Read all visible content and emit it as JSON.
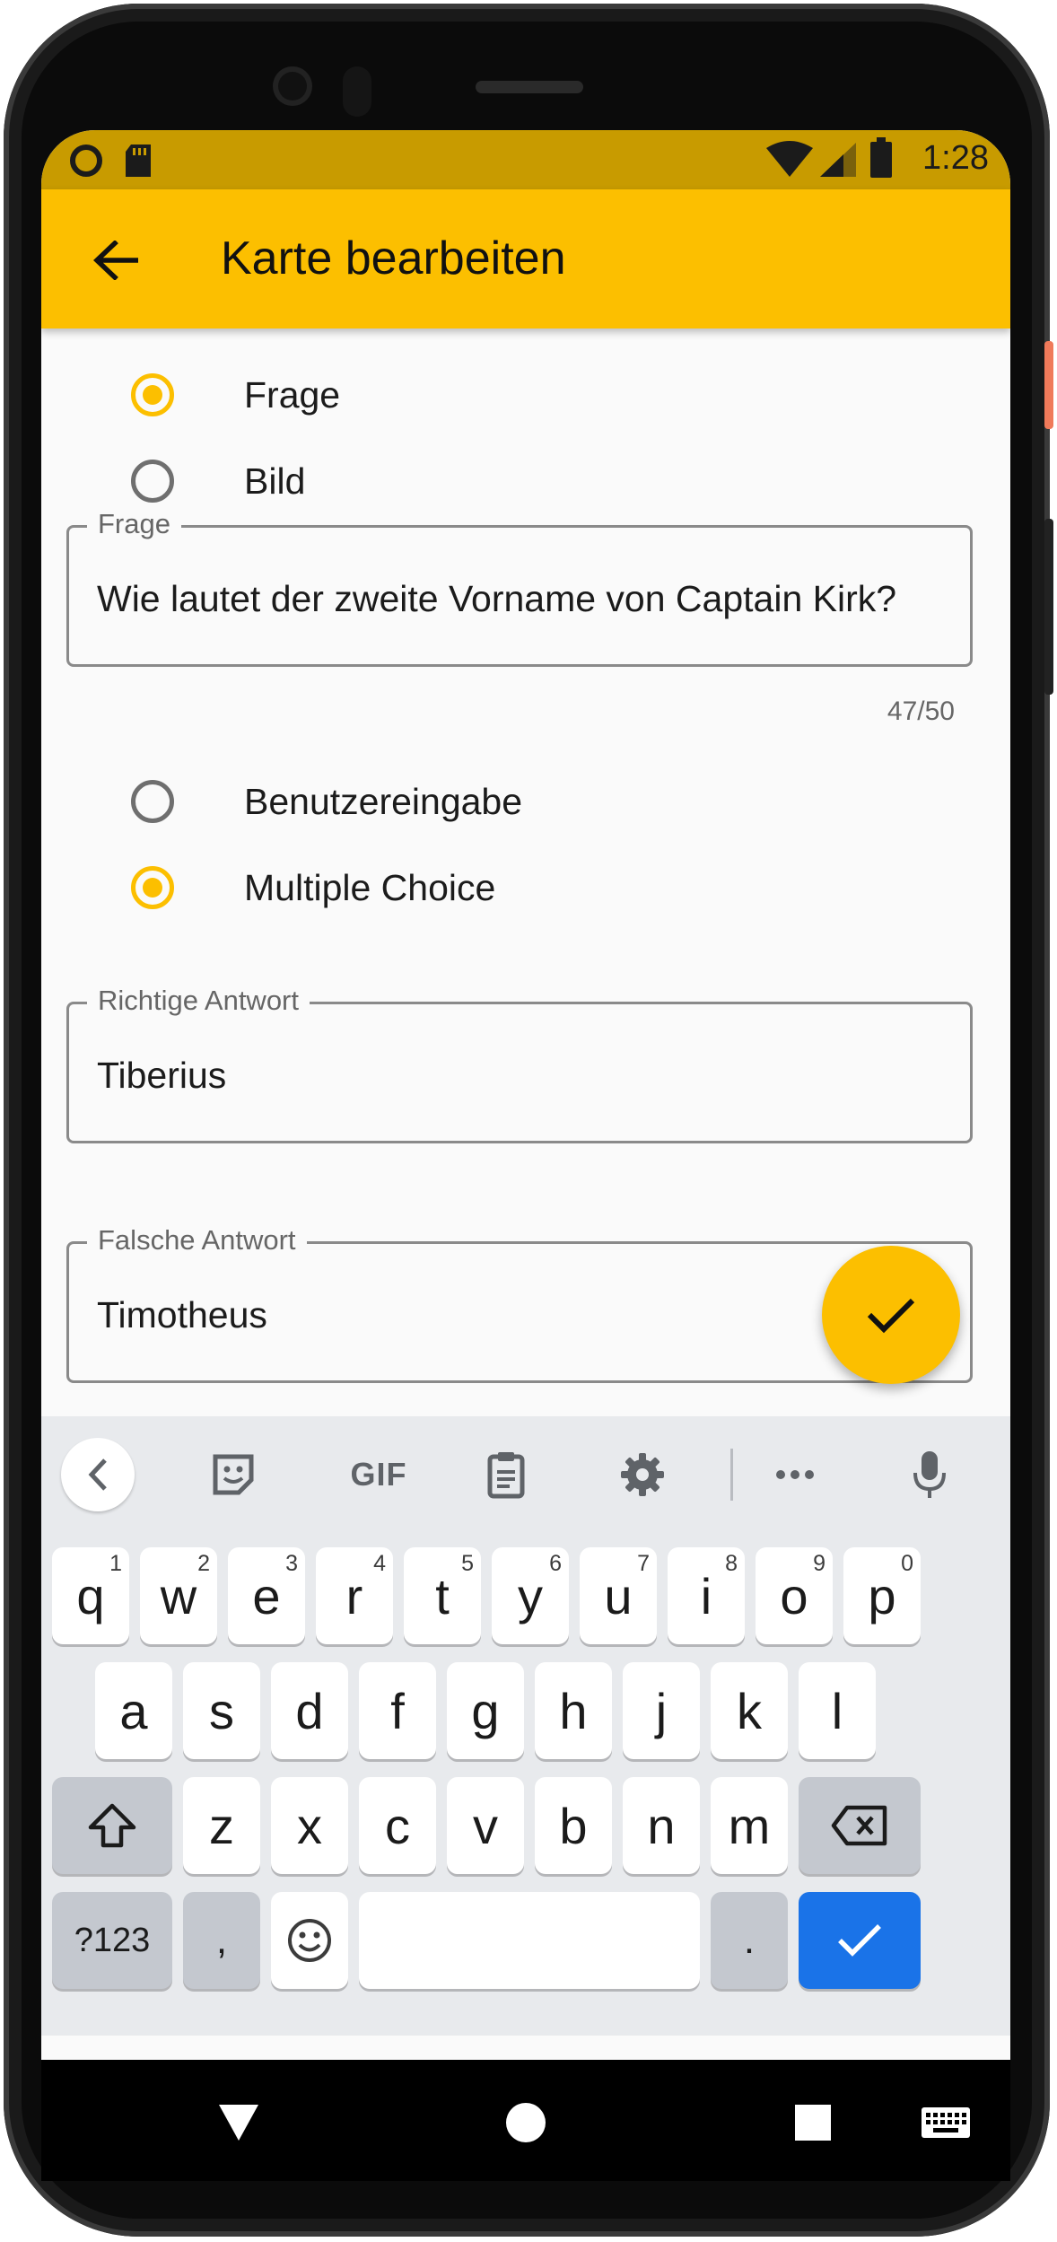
{
  "status_bar": {
    "time": "1:28",
    "left_icons": [
      "circle-notification-icon",
      "sd-card-icon"
    ],
    "right_icons": [
      "wifi-icon",
      "signal-icon",
      "battery-icon"
    ]
  },
  "app_bar": {
    "title": "Karte bearbeiten",
    "back_icon": "arrow-back-icon"
  },
  "question_type": {
    "options": [
      {
        "label": "Frage",
        "selected": true
      },
      {
        "label": "Bild",
        "selected": false
      }
    ]
  },
  "question_field": {
    "label": "Frage",
    "value": "Wie lautet der zweite Vorname von Captain Kirk?",
    "counter": "47/50"
  },
  "answer_type": {
    "options": [
      {
        "label": "Benutzereingabe",
        "selected": false
      },
      {
        "label": "Multiple Choice",
        "selected": true
      }
    ]
  },
  "correct_answer_field": {
    "label": "Richtige Antwort",
    "value": "Tiberius"
  },
  "wrong_answer_field": {
    "label": "Falsche Antwort",
    "value": "Timotheus"
  },
  "fab": {
    "icon": "check-icon"
  },
  "keyboard": {
    "toolbar": {
      "gif": "GIF"
    },
    "row1": [
      {
        "key": "q",
        "hint": "1"
      },
      {
        "key": "w",
        "hint": "2"
      },
      {
        "key": "e",
        "hint": "3"
      },
      {
        "key": "r",
        "hint": "4"
      },
      {
        "key": "t",
        "hint": "5"
      },
      {
        "key": "y",
        "hint": "6"
      },
      {
        "key": "u",
        "hint": "7"
      },
      {
        "key": "i",
        "hint": "8"
      },
      {
        "key": "o",
        "hint": "9"
      },
      {
        "key": "p",
        "hint": "0"
      }
    ],
    "row2": [
      "a",
      "s",
      "d",
      "f",
      "g",
      "h",
      "j",
      "k",
      "l"
    ],
    "row3": [
      "z",
      "x",
      "c",
      "v",
      "b",
      "n",
      "m"
    ],
    "row4": {
      "symbols": "?123",
      "comma": ",",
      "period": "."
    }
  },
  "colors": {
    "accent": "#fcbf00",
    "status_bar": "#c89b00",
    "keyboard_action": "#1a73e8"
  }
}
